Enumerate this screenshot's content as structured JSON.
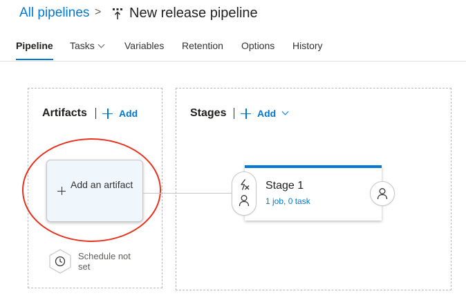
{
  "breadcrumb": {
    "root": "All pipelines",
    "separator": ">",
    "title": "New release pipeline"
  },
  "tabs": [
    {
      "label": "Pipeline",
      "active": true
    },
    {
      "label": "Tasks",
      "has_dropdown": true
    },
    {
      "label": "Variables"
    },
    {
      "label": "Retention"
    },
    {
      "label": "Options"
    },
    {
      "label": "History"
    }
  ],
  "artifacts": {
    "title": "Artifacts",
    "add_label": "Add",
    "card_label": "Add an artifact",
    "schedule_label": "Schedule not set"
  },
  "stages": {
    "title": "Stages",
    "add_label": "Add",
    "items": [
      {
        "name": "Stage 1",
        "summary": "1 job, 0 task"
      }
    ]
  },
  "colors": {
    "accent": "#0078d4",
    "highlight": "#e8301c"
  },
  "icons": [
    "pipeline-icon",
    "plus-icon",
    "chevron-down-icon",
    "trigger-icon",
    "user-icon",
    "clock-icon"
  ]
}
